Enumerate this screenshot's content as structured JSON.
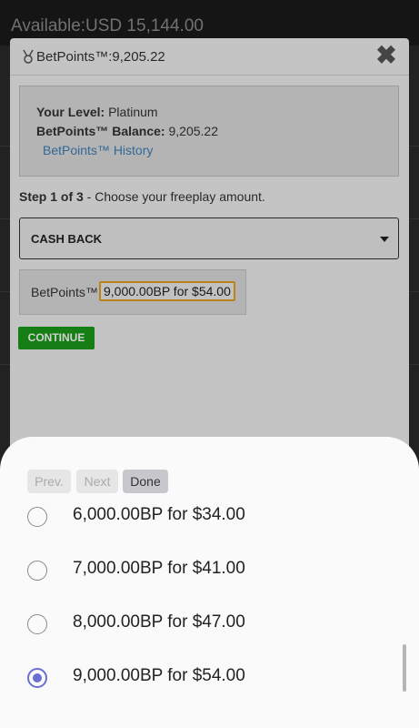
{
  "background": {
    "available_label": "Available:USD 15,144.00"
  },
  "modal": {
    "title": "BetPoints™:9,205.22",
    "close_label": "✖",
    "level_label": "Your Level:",
    "level_value": "Platinum",
    "balance_label": "BetPoints™ Balance:",
    "balance_value": "9,205.22",
    "history_link": "BetPoints™ History",
    "step_bold": "Step 1 of 3",
    "step_text": " - Choose your freeplay amount.",
    "select_value": "CASH BACK",
    "bp_label": "BetPoints™",
    "bp_selected": "9,000.00BP for  $54.00",
    "continue_label": "CONTINUE"
  },
  "picker": {
    "prev_label": "Prev.",
    "next_label": "Next",
    "done_label": "Done",
    "options": [
      {
        "label": "6,000.00BP for  $34.00",
        "checked": false
      },
      {
        "label": "7,000.00BP for  $41.00",
        "checked": false
      },
      {
        "label": "8,000.00BP for  $47.00",
        "checked": false
      },
      {
        "label": "9,000.00BP for  $54.00",
        "checked": true
      }
    ]
  },
  "colors": {
    "accent_radio": "#6b6fd1",
    "continue_green": "#1a9a1a",
    "link_blue": "#3d7fb8",
    "focus_orange": "#e0a020"
  },
  "icons": {
    "title_icon": "medal-icon",
    "close_icon": "close-icon",
    "select_icon": "caret-down-icon"
  }
}
